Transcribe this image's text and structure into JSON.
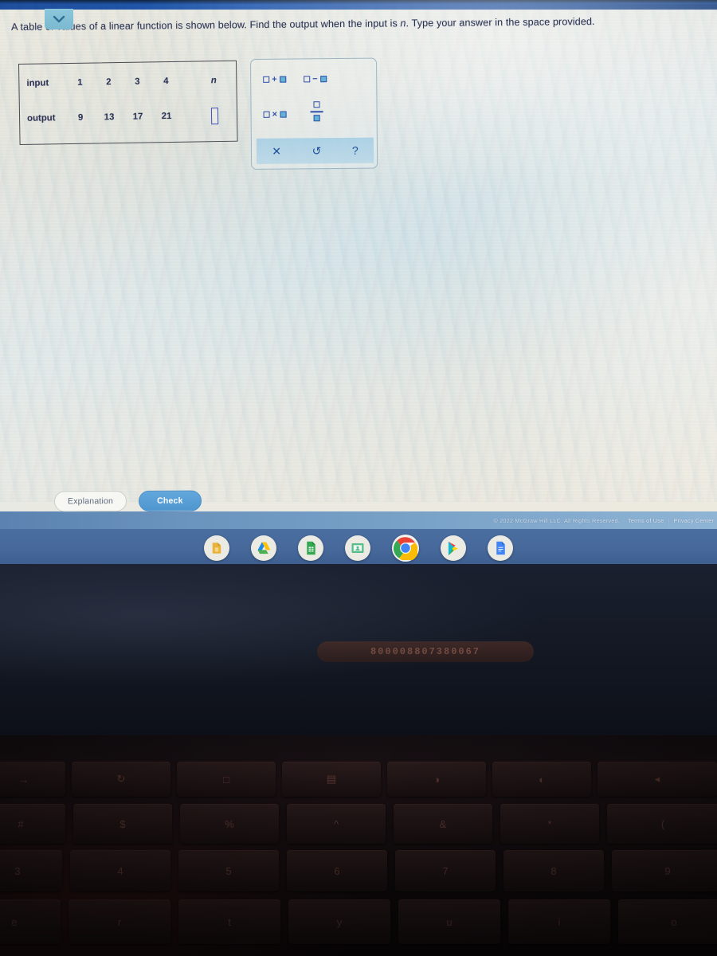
{
  "app": {
    "platform": "ChromeOS",
    "accent_blue": "#4e96cf",
    "panel_border": "#9bb6c6",
    "math_blue": "#2f4fa8",
    "fill_blue": "#63b3d8"
  },
  "question": {
    "collapse_tab_icon": "chevron-down-icon",
    "prompt_part1": "A table of values of a linear function is shown below. Find the output when the input is ",
    "prompt_variable": "n",
    "prompt_part2": ". Type your answer in the space provided."
  },
  "table": {
    "row_labels": [
      "input",
      "output"
    ],
    "input_values": [
      "1",
      "2",
      "3",
      "4"
    ],
    "input_variable": "n",
    "output_values": [
      "9",
      "13",
      "17",
      "21"
    ],
    "answer_value": ""
  },
  "keypad": {
    "buttons": [
      {
        "name": "addition-template",
        "symbol": "+"
      },
      {
        "name": "subtraction-template",
        "symbol": "−"
      },
      {
        "name": "multiplication-template",
        "symbol": "×"
      },
      {
        "name": "fraction-template",
        "symbol": "/"
      }
    ],
    "toolbar": [
      {
        "name": "clear-button",
        "glyph": "✕"
      },
      {
        "name": "undo-button",
        "glyph": "↺"
      },
      {
        "name": "help-button",
        "glyph": "?"
      }
    ]
  },
  "actions": {
    "explanation_label": "Explanation",
    "check_label": "Check"
  },
  "footer": {
    "copyright": "© 2022 McGraw Hill LLC. All Rights Reserved.",
    "terms_label": "Terms of Use",
    "separator": "|",
    "privacy_label": "Privacy Center"
  },
  "shelf": {
    "icons": [
      {
        "name": "google-keep-icon",
        "label": "Keep"
      },
      {
        "name": "google-drive-icon",
        "label": "Drive"
      },
      {
        "name": "google-sheets-icon",
        "label": "Sheets"
      },
      {
        "name": "google-classroom-icon",
        "label": "Classroom"
      },
      {
        "name": "google-chrome-icon",
        "label": "Chrome"
      },
      {
        "name": "google-play-store-icon",
        "label": "Play Store"
      },
      {
        "name": "google-docs-icon",
        "label": "Docs"
      }
    ]
  },
  "device": {
    "sticker_text": "800008807380067",
    "keyboard_row_function": [
      "→",
      "↻",
      "□",
      "▤",
      "◑",
      "◐",
      "◂"
    ],
    "keyboard_row_symbols": [
      "#",
      "$",
      "%",
      "^",
      "&",
      "*",
      "("
    ],
    "keyboard_row_numbers": [
      "3",
      "4",
      "5",
      "6",
      "7",
      "8",
      "9"
    ],
    "keyboard_row_letters": [
      "e",
      "r",
      "t",
      "y",
      "u",
      "i",
      "o"
    ]
  }
}
